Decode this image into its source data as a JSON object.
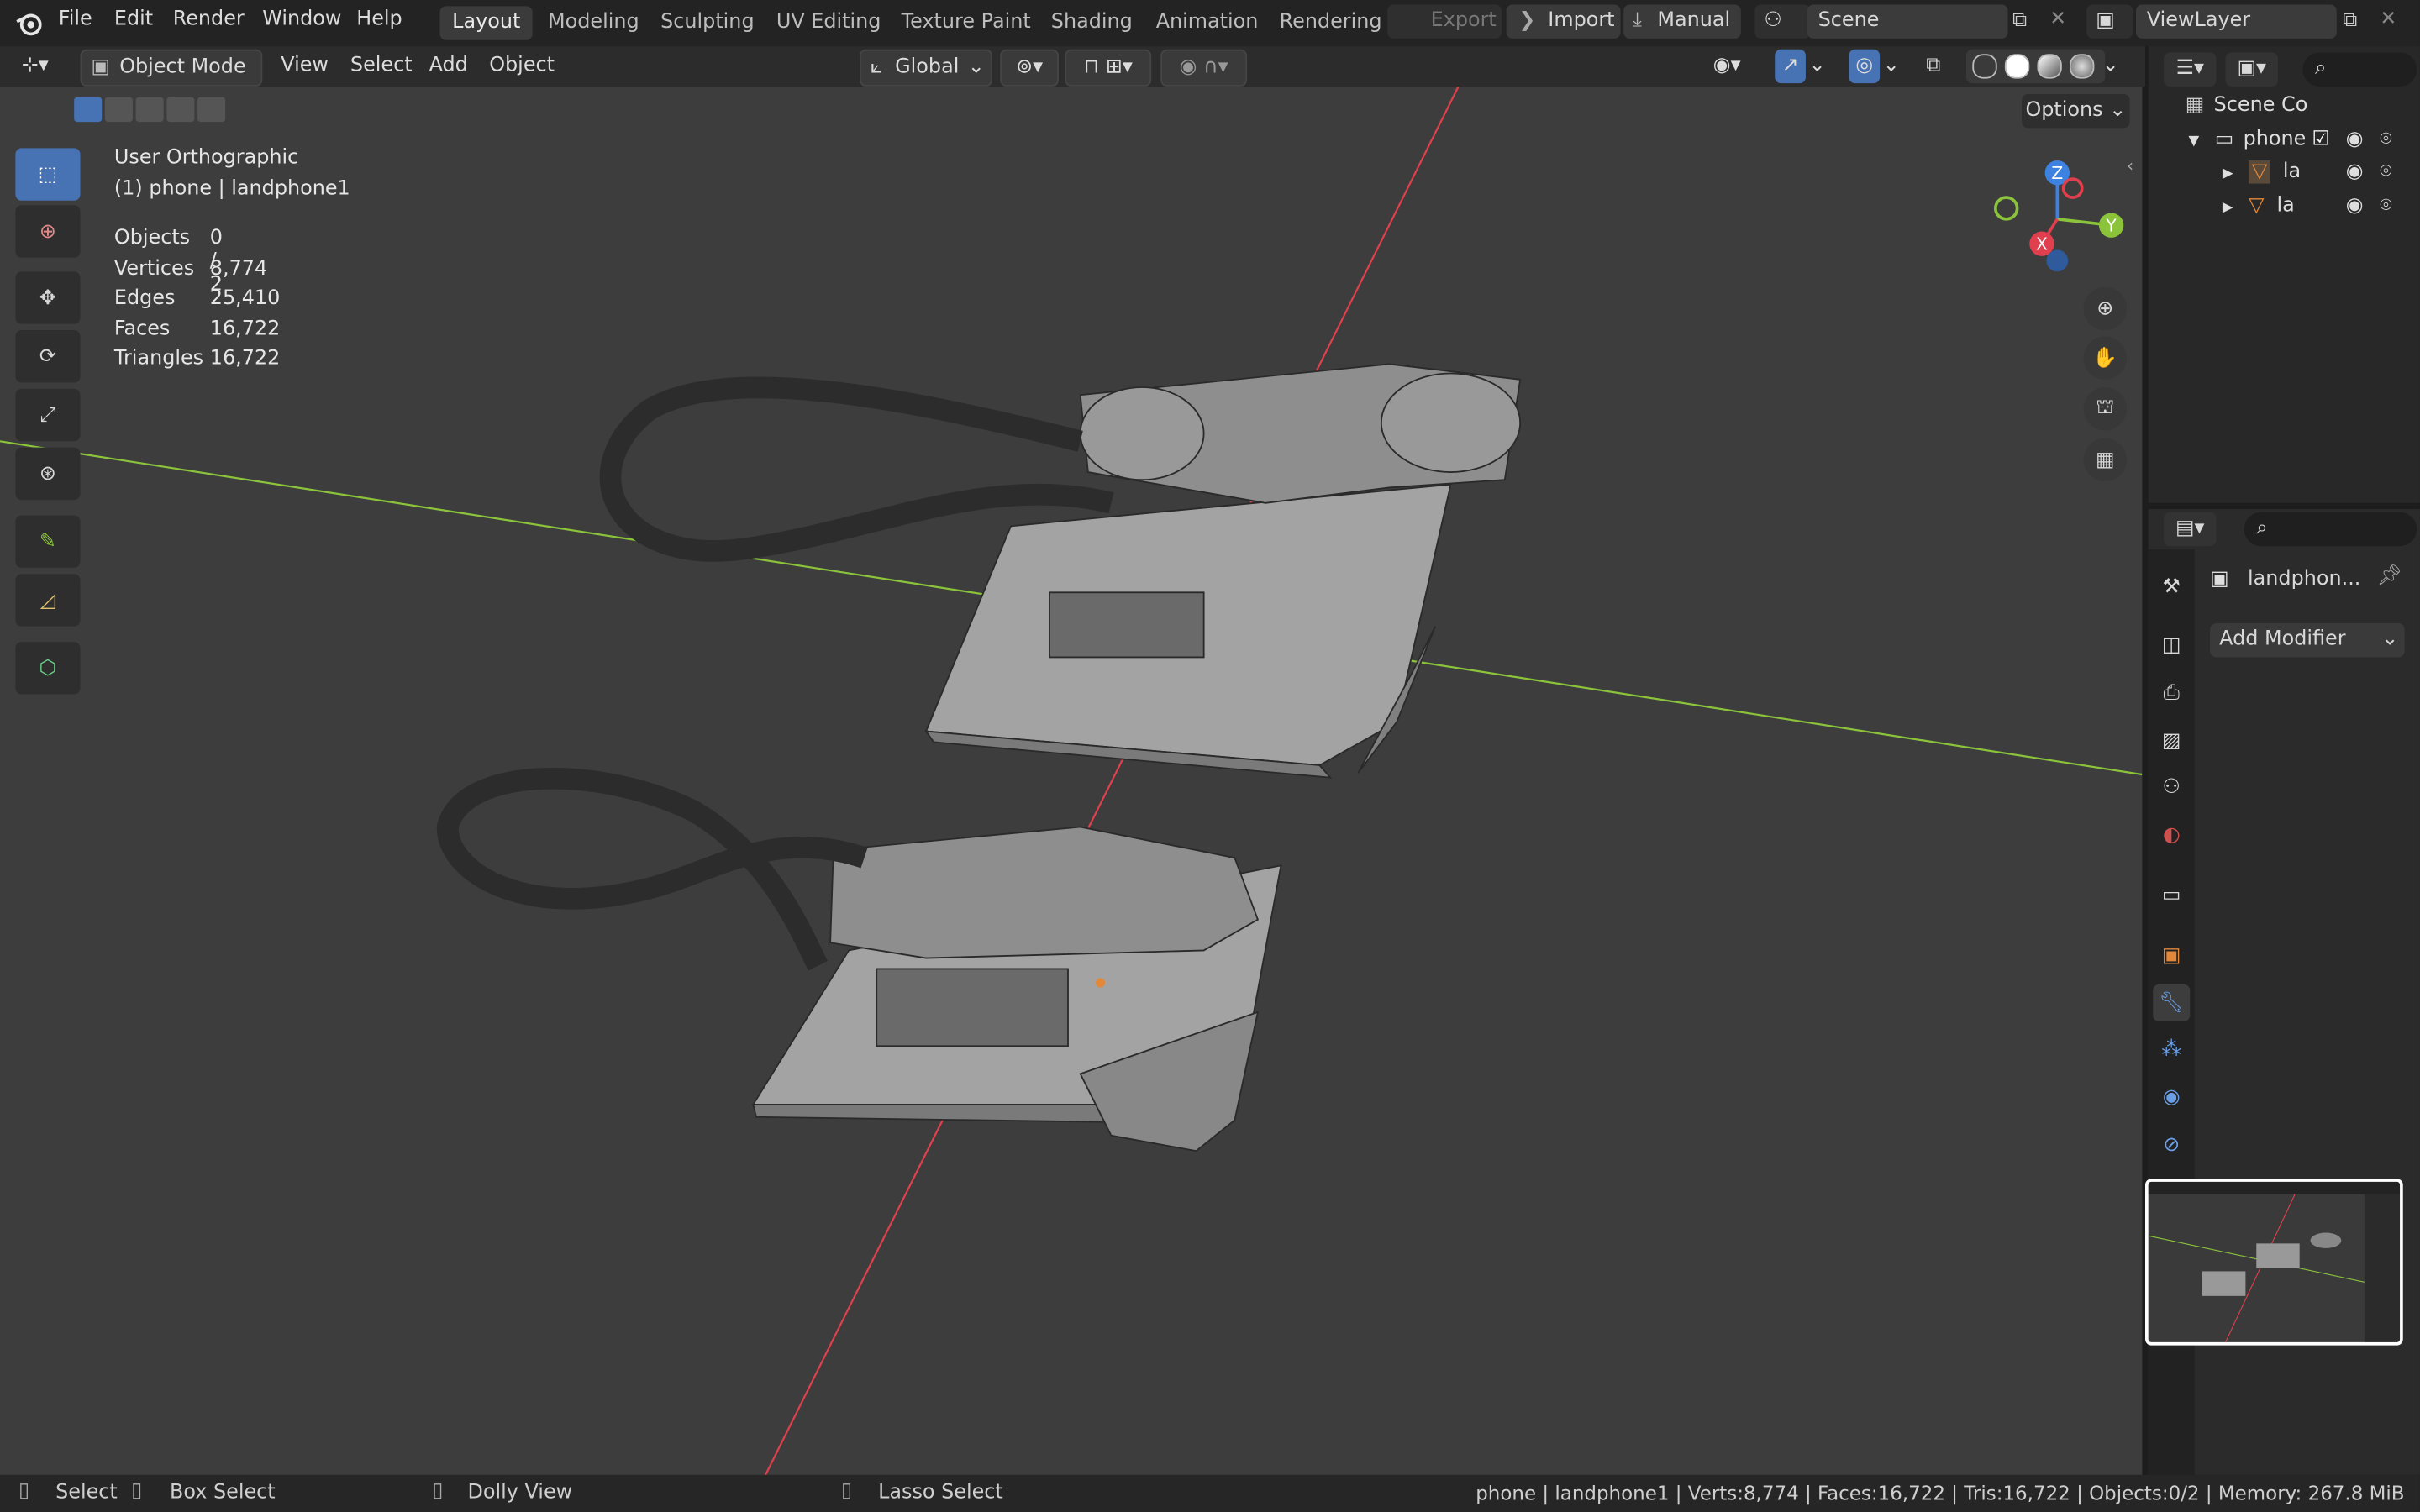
{
  "topbar": {
    "menus": [
      "File",
      "Edit",
      "Render",
      "Window",
      "Help"
    ],
    "workspaces": [
      "Layout",
      "Modeling",
      "Sculpting",
      "UV Editing",
      "Texture Paint",
      "Shading",
      "Animation",
      "Rendering"
    ],
    "export_label": "Export",
    "import_label": "Import",
    "manual_label": "Manual",
    "scene_name": "Scene",
    "view_layer": "ViewLayer"
  },
  "header": {
    "mode": "Object Mode",
    "menus": [
      "View",
      "Select",
      "Add",
      "Object"
    ],
    "orientation": "Global",
    "options_label": "Options"
  },
  "viewport": {
    "view_name": "User Orthographic",
    "active_object": "(1) phone | landphone1",
    "stats": [
      {
        "label": "Objects",
        "value": "0 / 2"
      },
      {
        "label": "Vertices",
        "value": "8,774"
      },
      {
        "label": "Edges",
        "value": "25,410"
      },
      {
        "label": "Faces",
        "value": "16,722"
      },
      {
        "label": "Triangles",
        "value": "16,722"
      }
    ],
    "gizmo_axes": {
      "x": "X",
      "y": "Y",
      "z": "Z"
    }
  },
  "outliner": {
    "root": "Scene Co",
    "collection": "phone",
    "items": [
      "la",
      "la"
    ]
  },
  "properties": {
    "object_name": "landphon...",
    "add_modifier_label": "Add Modifier"
  },
  "statusbar": {
    "hints": [
      "Select",
      "Box Select",
      "Dolly View",
      "Lasso Select"
    ],
    "info": "phone | landphone1 | Verts:8,774 | Faces:16,722 | Tris:16,722 | Objects:0/2 | Memory: 267.8 MiB"
  },
  "colors": {
    "accent": "#4772b3",
    "axis_x": "#e0404d",
    "axis_y": "#8bc43b",
    "axis_z": "#3d82e0",
    "object_orange": "#e3883a"
  }
}
